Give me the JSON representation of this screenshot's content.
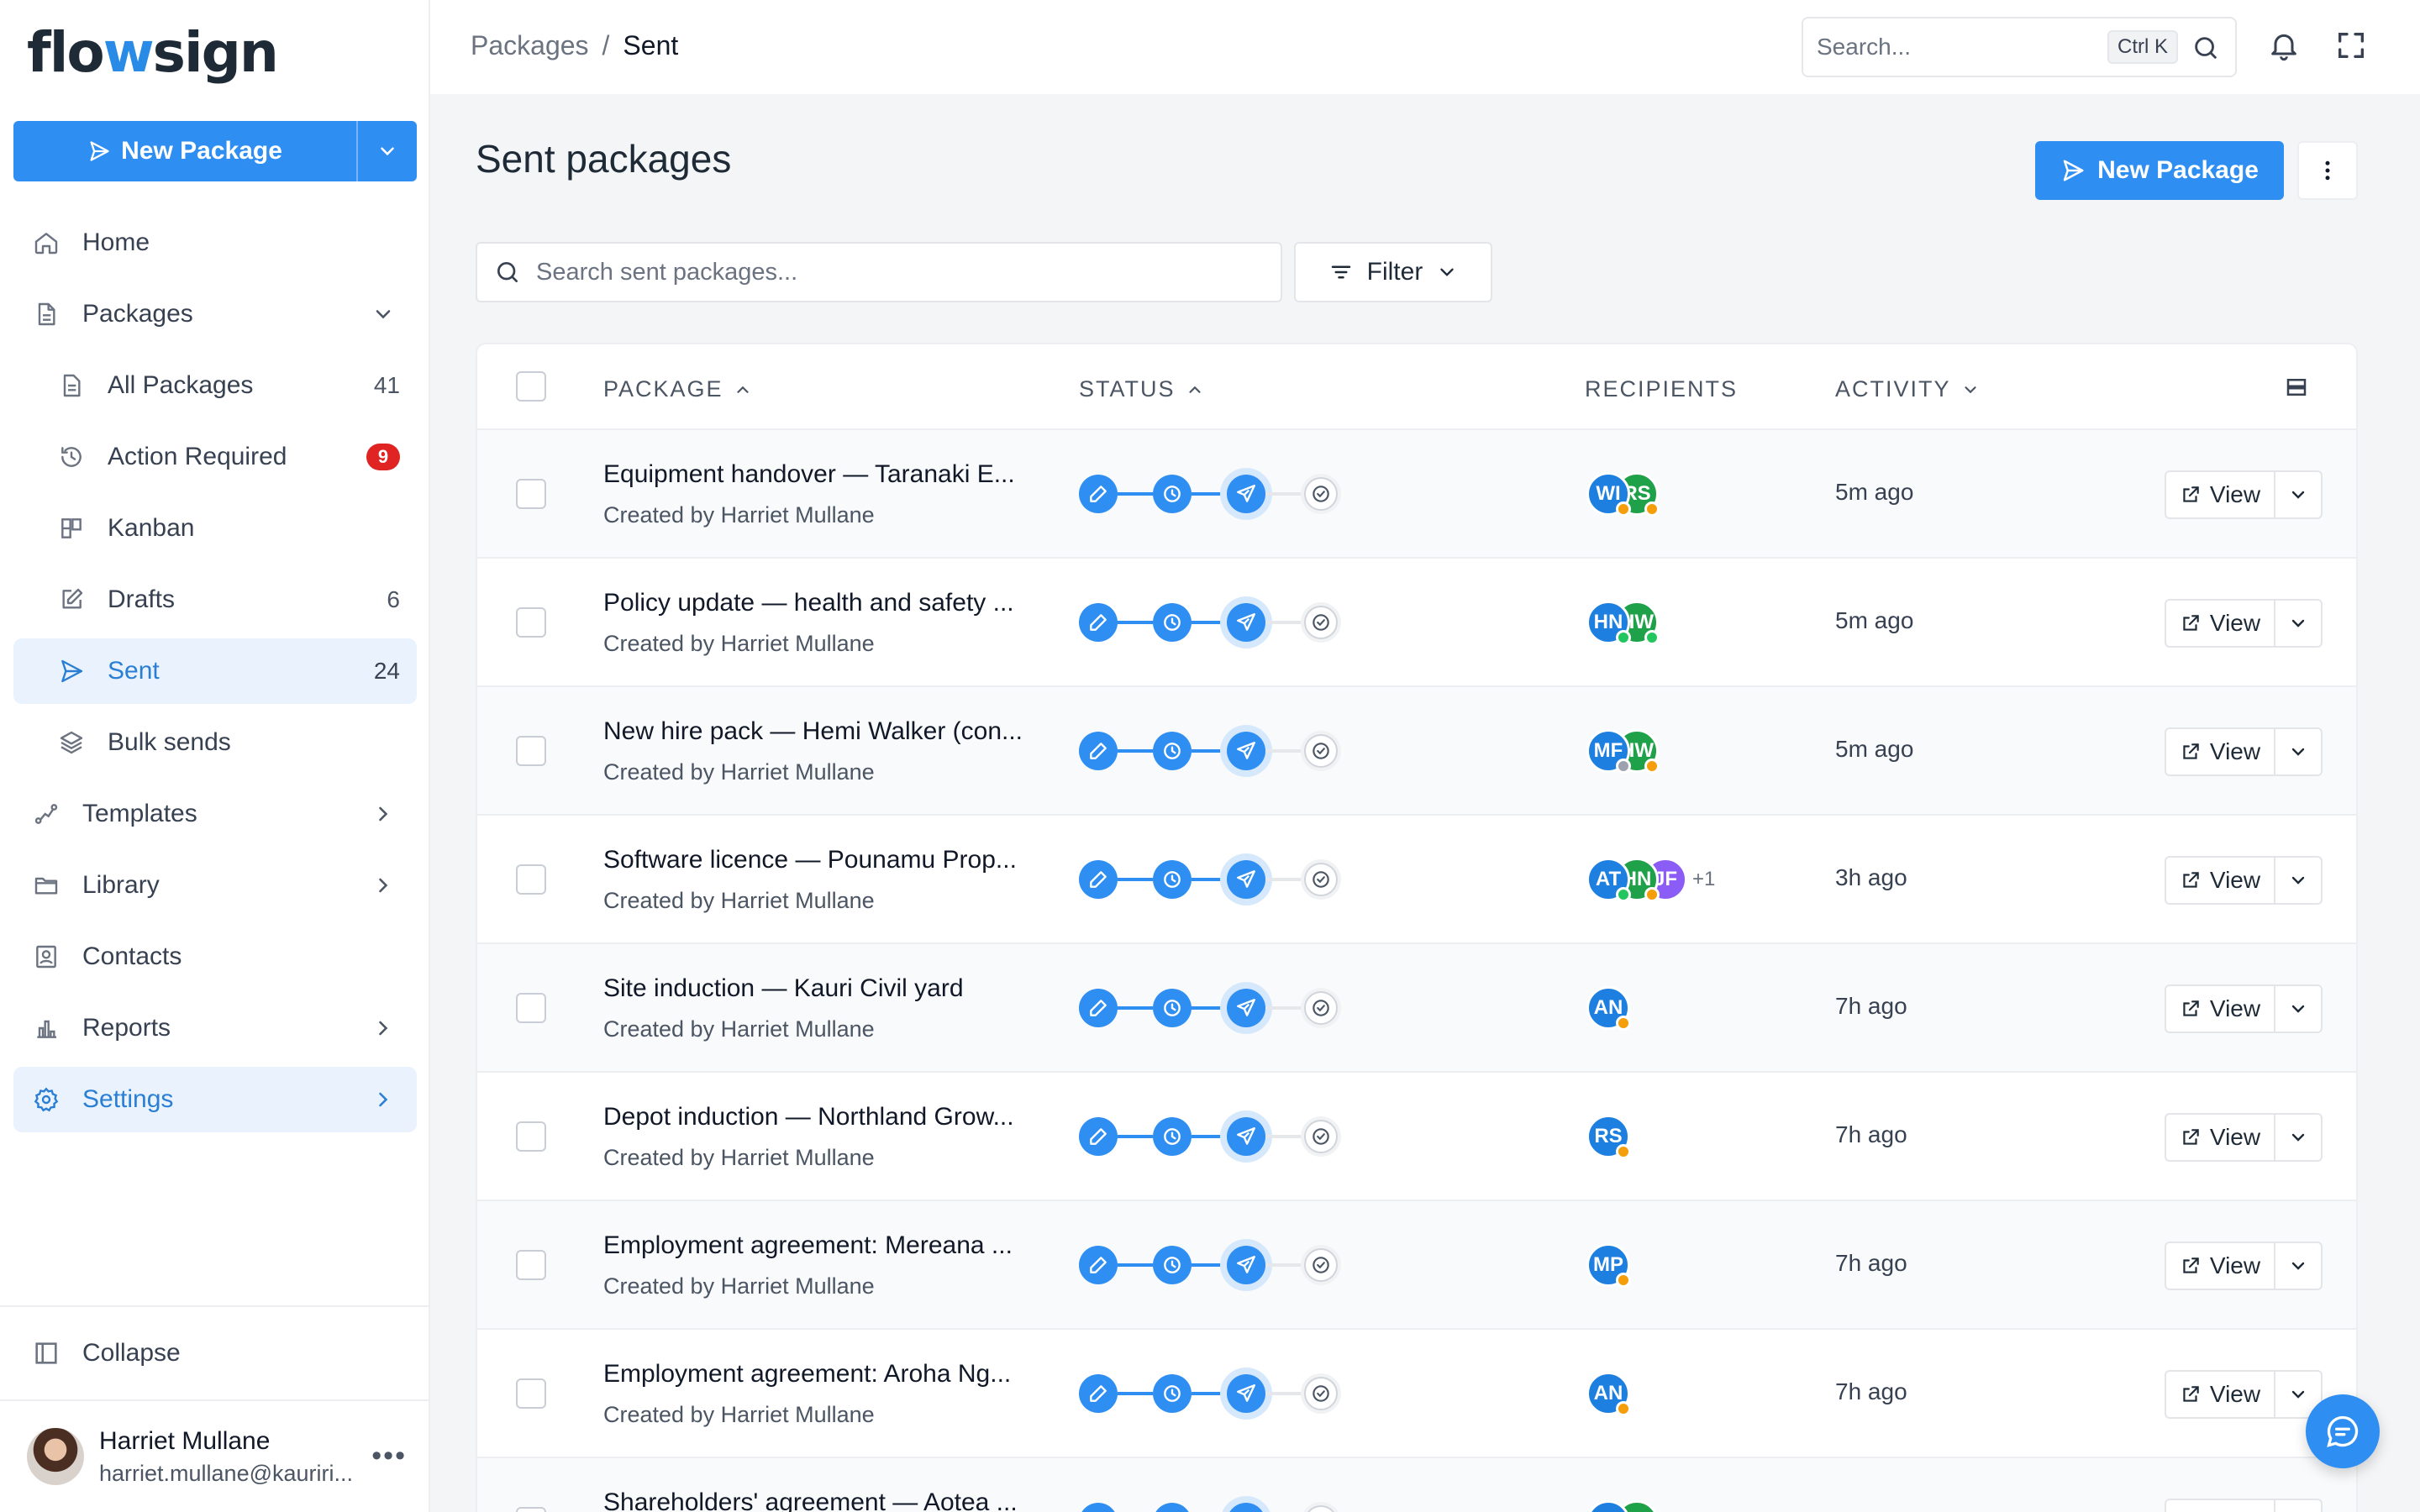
{
  "brand": {
    "logo_pre": "flo",
    "logo_wave": "w",
    "logo_post": "sign"
  },
  "sidebar": {
    "new_package_label": "New Package",
    "items": [
      {
        "label": "Home",
        "icon": "home-icon"
      },
      {
        "label": "Packages",
        "icon": "document-icon"
      },
      {
        "label": "All Packages",
        "icon": "file-icon",
        "count": "41"
      },
      {
        "label": "Action Required",
        "icon": "history-icon",
        "badge": "9"
      },
      {
        "label": "Kanban",
        "icon": "kanban-icon"
      },
      {
        "label": "Drafts",
        "icon": "edit-icon",
        "count": "6"
      },
      {
        "label": "Sent",
        "icon": "send-icon",
        "count": "24"
      },
      {
        "label": "Bulk sends",
        "icon": "layers-icon"
      },
      {
        "label": "Templates",
        "icon": "route-icon"
      },
      {
        "label": "Library",
        "icon": "folder-icon"
      },
      {
        "label": "Contacts",
        "icon": "contact-icon"
      },
      {
        "label": "Reports",
        "icon": "bar-chart-icon"
      },
      {
        "label": "Settings",
        "icon": "gear-icon"
      }
    ],
    "collapse_label": "Collapse",
    "user": {
      "name": "Harriet Mullane",
      "email": "harriet.mullane@kauriri..."
    }
  },
  "topbar": {
    "breadcrumb": [
      "Packages",
      "Sent"
    ],
    "search_placeholder": "Search...",
    "shortcut": "Ctrl K"
  },
  "main": {
    "title": "Sent packages",
    "new_package_label": "New Package",
    "search_placeholder": "Search sent packages...",
    "filter_label": "Filter",
    "columns": {
      "package": "PACKAGE",
      "status": "STATUS",
      "recipients": "RECIPIENTS",
      "activity": "ACTIVITY"
    },
    "view_label": "View",
    "rows": [
      {
        "title": "Equipment handover — Taranaki E...",
        "created_by": "Created by Harriet Mullane",
        "activity": "5m ago",
        "recipients": [
          {
            "initials": "WI",
            "color": "#1d7fe0",
            "status": "#f59e0b"
          },
          {
            "initials": "RS",
            "color": "#1fa149",
            "status": "#f59e0b"
          }
        ],
        "more": ""
      },
      {
        "title": "Policy update — health and safety ...",
        "created_by": "Created by Harriet Mullane",
        "activity": "5m ago",
        "recipients": [
          {
            "initials": "HN",
            "color": "#1d7fe0",
            "status": "#22c55e"
          },
          {
            "initials": "HW",
            "color": "#1fa149",
            "status": "#22c55e"
          }
        ],
        "more": ""
      },
      {
        "title": "New hire pack — Hemi Walker (con...",
        "created_by": "Created by Harriet Mullane",
        "activity": "5m ago",
        "recipients": [
          {
            "initials": "MF",
            "color": "#1d7fe0",
            "status": "#9ca3af"
          },
          {
            "initials": "HW",
            "color": "#1fa149",
            "status": "#f59e0b"
          }
        ],
        "more": ""
      },
      {
        "title": "Software licence — Pounamu Prop...",
        "created_by": "Created by Harriet Mullane",
        "activity": "3h ago",
        "recipients": [
          {
            "initials": "AT",
            "color": "#1d7fe0",
            "status": "#22c55e"
          },
          {
            "initials": "HN",
            "color": "#1fa149",
            "status": "#f59e0b"
          },
          {
            "initials": "JF",
            "color": "#8b5cf6",
            "status": ""
          }
        ],
        "more": "+1"
      },
      {
        "title": "Site induction — Kauri Civil yard",
        "created_by": "Created by Harriet Mullane",
        "activity": "7h ago",
        "recipients": [
          {
            "initials": "AN",
            "color": "#1d7fe0",
            "status": "#f59e0b"
          }
        ],
        "more": ""
      },
      {
        "title": "Depot induction — Northland Grow...",
        "created_by": "Created by Harriet Mullane",
        "activity": "7h ago",
        "recipients": [
          {
            "initials": "RS",
            "color": "#1d7fe0",
            "status": "#f59e0b"
          }
        ],
        "more": ""
      },
      {
        "title": "Employment agreement: Mereana ...",
        "created_by": "Created by Harriet Mullane",
        "activity": "7h ago",
        "recipients": [
          {
            "initials": "MP",
            "color": "#1d7fe0",
            "status": "#f59e0b"
          }
        ],
        "more": ""
      },
      {
        "title": "Employment agreement: Aroha Ng...",
        "created_by": "Created by Harriet Mullane",
        "activity": "7h ago",
        "recipients": [
          {
            "initials": "AN",
            "color": "#1d7fe0",
            "status": "#f59e0b"
          }
        ],
        "more": ""
      },
      {
        "title": "Shareholders' agreement — Aotea ...",
        "created_by": "",
        "activity": "",
        "recipients": [
          {
            "initials": "",
            "color": "#1d7fe0",
            "status": ""
          },
          {
            "initials": "",
            "color": "#1fa149",
            "status": ""
          }
        ],
        "more": ""
      }
    ]
  }
}
